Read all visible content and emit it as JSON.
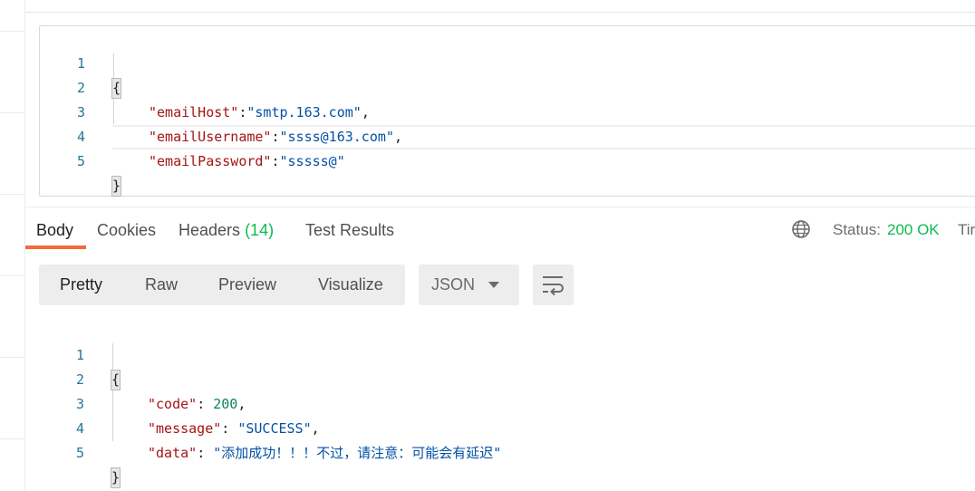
{
  "request_body": {
    "lines": [
      {
        "num": "1",
        "text": "{"
      },
      {
        "num": "2",
        "key": "\"emailHost\"",
        "sep": ":",
        "value": "\"smtp.163.com\"",
        "tail": ","
      },
      {
        "num": "3",
        "key": "\"emailUsername\"",
        "sep": ":",
        "value": "\"ssss@163.com\"",
        "tail": ","
      },
      {
        "num": "4",
        "key": "\"emailPassword\"",
        "sep": ":",
        "value": "\"sssss@\"",
        "tail": ""
      },
      {
        "num": "5",
        "text": "}"
      }
    ]
  },
  "response_tabs": {
    "body": "Body",
    "cookies": "Cookies",
    "headers": "Headers",
    "headers_count": "(14)",
    "test_results": "Test Results"
  },
  "status": {
    "label": "Status:",
    "value": "200 OK",
    "time_label": "Tir"
  },
  "format_tabs": {
    "pretty": "Pretty",
    "raw": "Raw",
    "preview": "Preview",
    "visualize": "Visualize"
  },
  "language_select": {
    "selected": "JSON"
  },
  "response_body": {
    "lines": [
      {
        "num": "1",
        "text": "{"
      },
      {
        "num": "2",
        "key": "\"code\"",
        "sep": ": ",
        "value": "200",
        "tail": ","
      },
      {
        "num": "3",
        "key": "\"message\"",
        "sep": ": ",
        "value": "\"SUCCESS\"",
        "tail": ","
      },
      {
        "num": "4",
        "key": "\"data\"",
        "sep": ": ",
        "value": "\"添加成功！！！不过，请注意：可能会有延迟\"",
        "tail": ""
      },
      {
        "num": "5",
        "text": "}"
      }
    ]
  },
  "icons": {
    "globe": "globe-icon",
    "caret": "chevron-down-icon",
    "wrap": "wrap-lines-icon"
  },
  "colors": {
    "accent": "#f26b3a",
    "success": "#0cbb52",
    "json_key": "#a31515",
    "json_string": "#0451a5",
    "json_number": "#098658",
    "line_number": "#237893"
  }
}
